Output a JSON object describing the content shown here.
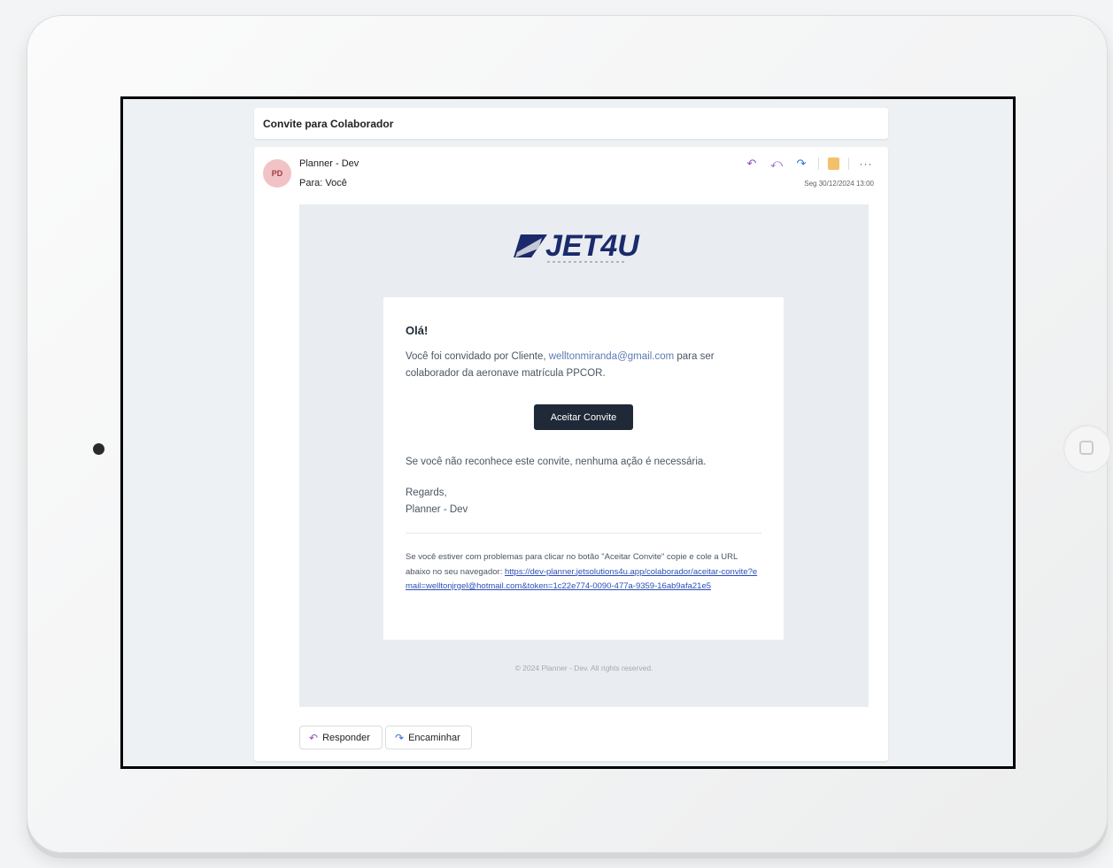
{
  "email": {
    "subject": "Convite para Colaborador",
    "avatar_initials": "PD",
    "sender": "Planner - Dev",
    "recipient": "Para: Você",
    "date": "Seg 30/12/2024 13:00",
    "toolbar_icons": [
      "reply-icon",
      "reply-all-icon",
      "forward-icon",
      "note-icon",
      "more-icon"
    ],
    "more_label": "···"
  },
  "body": {
    "logo_text": "JET4U",
    "greeting": "Olá!",
    "invite_prefix": "Você foi convidado por Cliente,",
    "invite_email": "welltonmiranda@gmail.com",
    "invite_suffix": "para ser colaborador da aeronave matrícula PPCOR.",
    "accept_button": "Aceitar Convite",
    "ignore_text": "Se você não reconhece este convite, nenhuma ação é necessária.",
    "regards": "Regards,",
    "signature": "Planner - Dev",
    "trouble_text": "Se você estiver com problemas para clicar no botão \"Aceitar Convite\" copie e cole a URL abaixo no seu navegador:",
    "trouble_url": "https://dev-planner.jetsolutions4u.app/colaborador/aceitar-convite?email=welltonjrgel@hotmail.com&token=1c22e774-0090-477a-9359-16ab9afa21e5",
    "footer": "© 2024 Planner - Dev. All rights reserved."
  },
  "actions": {
    "reply_label": "Responder",
    "forward_label": "Encaminhar"
  },
  "colors": {
    "accent_reply": "#8e4ec6",
    "accent_forward": "#2f6fd6",
    "button_dark": "#1f2937",
    "logo_navy": "#1b2a6b"
  }
}
